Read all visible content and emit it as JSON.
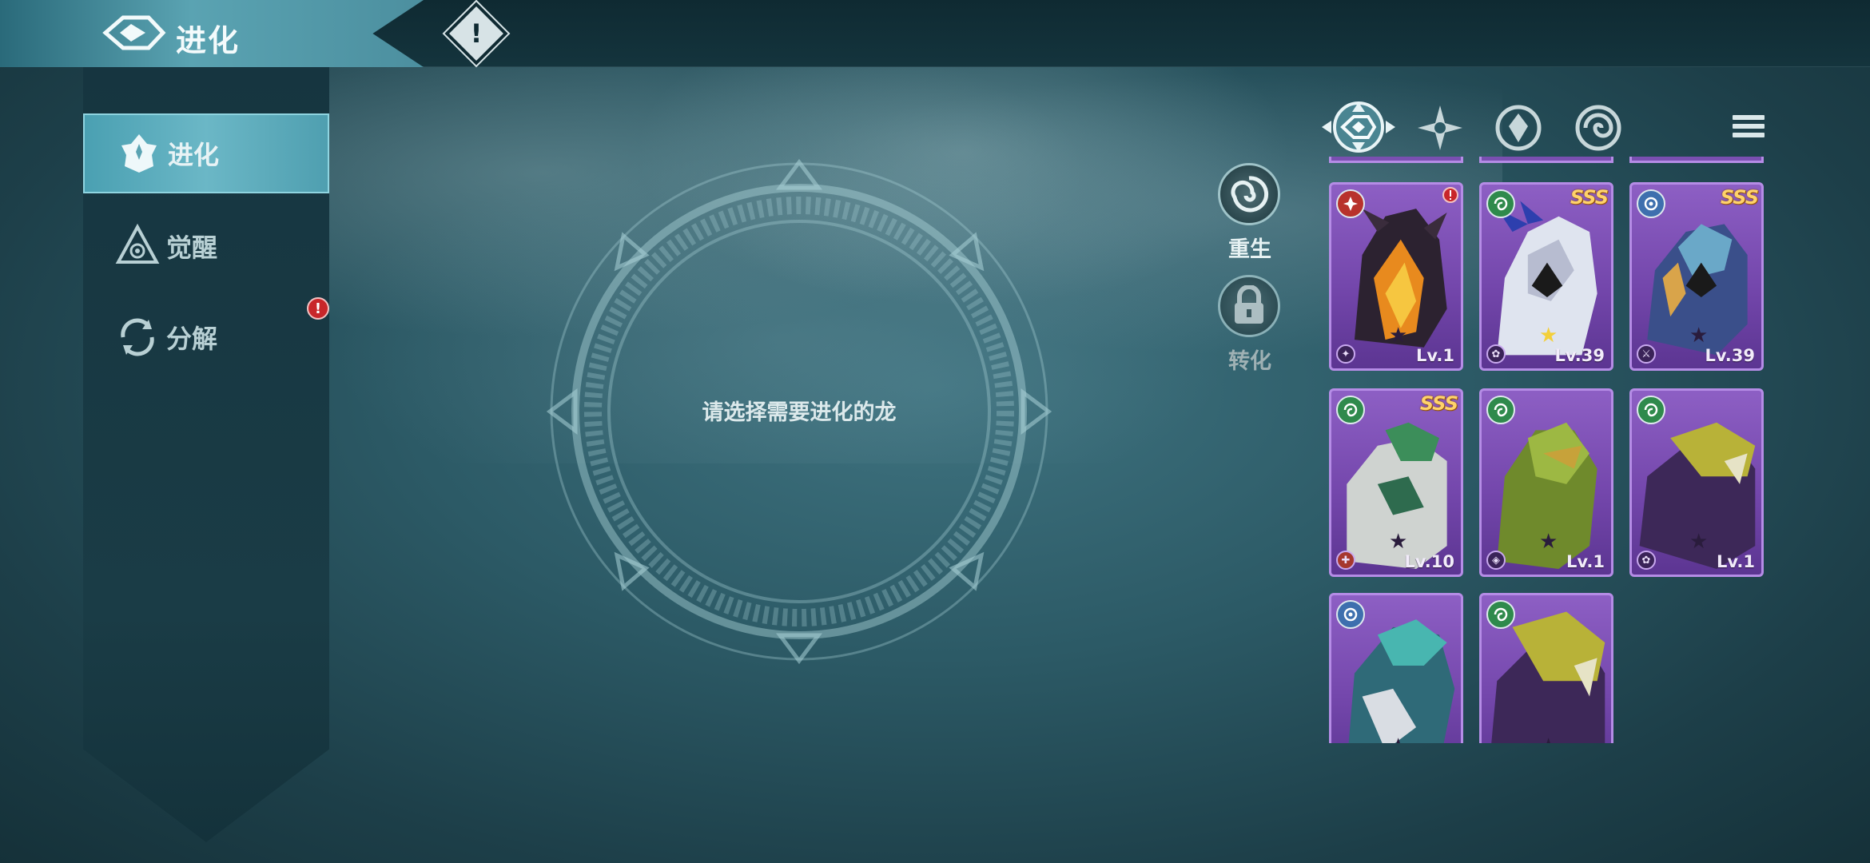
{
  "header": {
    "title": "进化",
    "alert_glyph": "!"
  },
  "sidebar": {
    "items": [
      {
        "label": "进化",
        "icon": "evolve-flower-icon",
        "active": true
      },
      {
        "label": "觉醒",
        "icon": "awaken-triangle-icon",
        "active": false
      },
      {
        "label": "分解",
        "icon": "decompose-cycle-icon",
        "active": false,
        "badge": "!"
      }
    ]
  },
  "center": {
    "prompt": "请选择需要进化的龙"
  },
  "actions": {
    "rebirth_label": "重生",
    "convert_label": "转化"
  },
  "filters": [
    "all-filter-icon",
    "star-filter-icon",
    "crest-filter-icon",
    "swirl-filter-icon"
  ],
  "dragons": [
    {
      "element": "fire",
      "rarity": "",
      "stars": 1,
      "gold_star": false,
      "level": "Lv.1",
      "role": "wing",
      "alert": true
    },
    {
      "element": "wind",
      "rarity": "SSS",
      "stars": 1,
      "gold_star": true,
      "level": "Lv.39",
      "role": "paw",
      "alert": false
    },
    {
      "element": "water",
      "rarity": "SSS",
      "stars": 1,
      "gold_star": false,
      "level": "Lv.39",
      "role": "blade",
      "alert": false
    },
    {
      "element": "wind",
      "rarity": "SSS",
      "stars": 1,
      "gold_star": false,
      "level": "Lv.10",
      "role": "axe",
      "alert": false
    },
    {
      "element": "wind",
      "rarity": "",
      "stars": 1,
      "gold_star": false,
      "level": "Lv.1",
      "role": "shield",
      "alert": false
    },
    {
      "element": "wind",
      "rarity": "",
      "stars": 1,
      "gold_star": false,
      "level": "Lv.1",
      "role": "paw",
      "alert": false
    },
    {
      "element": "water",
      "rarity": "",
      "stars": 1,
      "gold_star": false,
      "level": "",
      "role": "",
      "alert": false
    },
    {
      "element": "wind",
      "rarity": "",
      "stars": 1,
      "gold_star": false,
      "level": "",
      "role": "",
      "alert": false
    }
  ],
  "colors": {
    "background": "#2c5a66",
    "card_purple": "#7447ac",
    "accent_teal": "#5aa3b2",
    "alert_red": "#c8262a",
    "sss_gold": "#ffd36a"
  }
}
